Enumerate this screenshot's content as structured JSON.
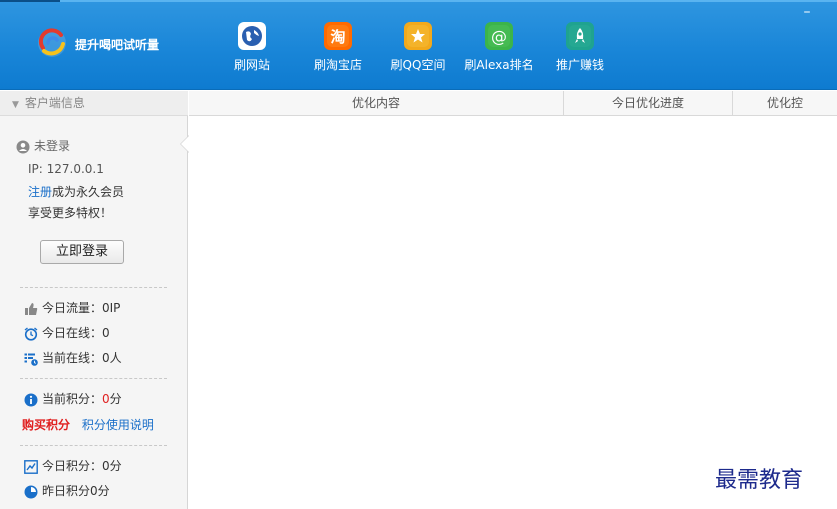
{
  "header": {
    "app_title": "提升喝吧试听量",
    "minimize_label": "–",
    "nav": [
      {
        "label": "刷网站",
        "icon": "globe-icon",
        "color": "#2a5fb0"
      },
      {
        "label": "刷淘宝店",
        "icon": "taobao-icon",
        "color": "#ff6a00"
      },
      {
        "label": "刷QQ空间",
        "icon": "star-icon",
        "color": "#f2a91c"
      },
      {
        "label": "刷Alexa排名",
        "icon": "at-sign-icon",
        "color": "#3cb44a"
      },
      {
        "label": "推广赚钱",
        "icon": "rocket-icon",
        "color": "#1fa38f"
      }
    ]
  },
  "sidebar": {
    "title": "客户端信息",
    "user_status": "未登录",
    "ip": "IP: 127.0.0.1",
    "register_link": "注册",
    "register_suffix": "成为永久会员",
    "privilege_text": "享受更多特权！",
    "login_button": "立即登录",
    "stats": [
      {
        "label": "今日流量：0IP",
        "icon": "thumbs-up-icon"
      },
      {
        "label": "今日在线：0",
        "icon": "alarm-clock-icon"
      },
      {
        "label": "当前在线：0人",
        "icon": "list-clock-icon"
      }
    ],
    "points": {
      "label": "当前积分：",
      "value": "0",
      "unit": "分",
      "buy_link": "购买积分",
      "help_link": "积分使用说明",
      "value_color": "#e02020"
    },
    "daily": [
      {
        "label": "今日积分：0分",
        "icon": "chart-icon"
      },
      {
        "label": "昨日积分0分",
        "icon": "pie-clock-icon"
      }
    ]
  },
  "table": {
    "columns": [
      "优化内容",
      "今日优化进度",
      "优化控"
    ]
  },
  "watermark": "最需教育",
  "colors": {
    "header_blue": "#1a86d8",
    "link_blue": "#1a6fc9",
    "buy_red": "#e02020"
  }
}
